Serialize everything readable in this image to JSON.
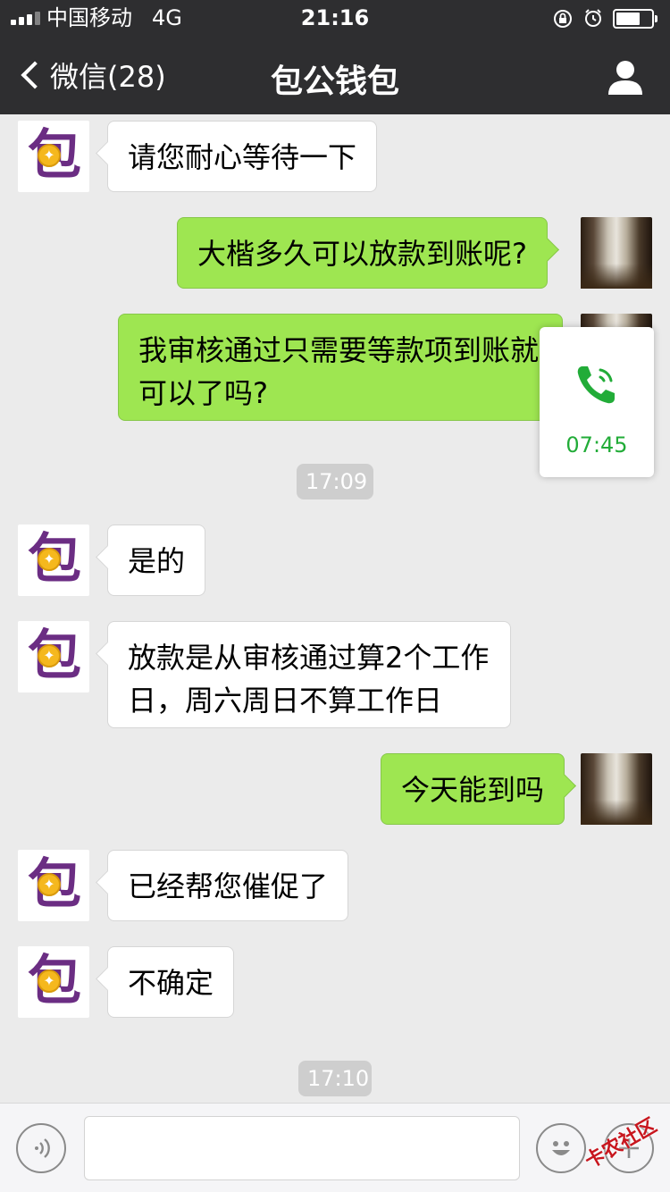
{
  "status_bar": {
    "carrier": "中国移动",
    "network": "4G",
    "time": "21:16"
  },
  "nav": {
    "back_label": "微信(28)",
    "title": "包公钱包"
  },
  "contact_avatar": {
    "glyph": "包"
  },
  "messages": [
    {
      "from": "them",
      "text": "请您耐心等待一下"
    },
    {
      "from": "me",
      "text": "大楷多久可以放款到账呢?"
    },
    {
      "from": "me",
      "text": "我审核通过只需要等款项到账就可以了吗?"
    },
    {
      "from": "them",
      "text": "是的"
    },
    {
      "from": "them",
      "text": "放款是从审核通过算2个工作日，周六周日不算工作日"
    },
    {
      "from": "me",
      "text": "今天能到吗"
    },
    {
      "from": "them",
      "text": "已经帮您催促了"
    },
    {
      "from": "them",
      "text": "不确定"
    }
  ],
  "timestamps": [
    "17:09",
    "17:10"
  ],
  "call_card": {
    "duration": "07:45",
    "accent_color": "#22ac38"
  },
  "watermark": {
    "text": "卡农社区"
  },
  "colors": {
    "bar": "#2e2e30",
    "outgoing_bubble": "#9ee651",
    "background": "#ebebeb"
  }
}
